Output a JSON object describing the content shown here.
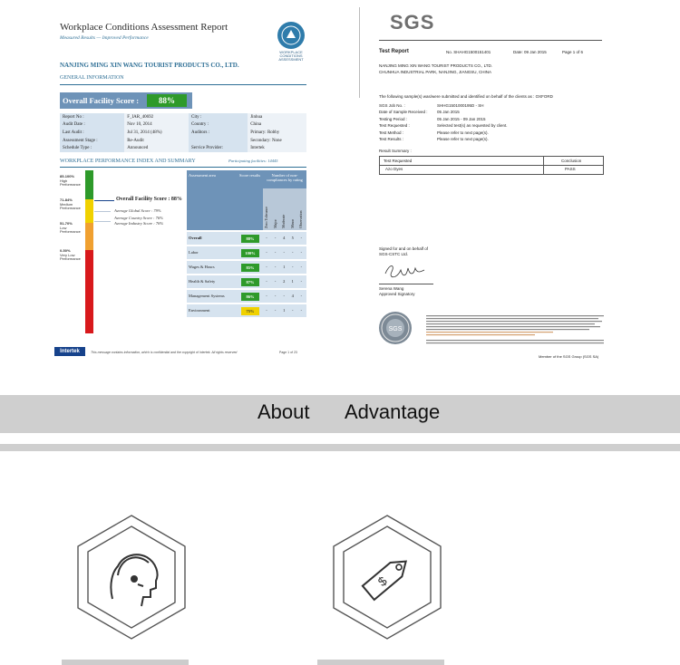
{
  "report": {
    "title": "Workplace Conditions Assessment Report",
    "subtitle": "Measured Results — Improved Performance",
    "logo_text": "WORKPLACE CONDITIONS ASSESSMENT",
    "company": "NANJING MING XIN WANG TOURIST PRODUCTS CO., LTD.",
    "general_info_header": "GENERAL INFORMATION",
    "overall_label": "Overall Facility Score :",
    "overall_value": "88%",
    "info_rows": [
      [
        "Report No :",
        "F_IAR_40692",
        "City :",
        "Jinhua"
      ],
      [
        "Audit Date :",
        "Nov 10, 2014",
        "Country :",
        "China"
      ],
      [
        "Last Audit :",
        "Jul 31, 2014 (48%)",
        "Auditors :",
        "Primary: Robby"
      ],
      [
        "Assessment Stage :",
        "Re-Audit",
        "",
        "Secondary: None"
      ],
      [
        "Schedule Type :",
        "Announced",
        "Service Provider:",
        "Intertek"
      ]
    ],
    "summary_header": "WORKPLACE PERFORMANCE INDEX AND SUMMARY",
    "participating": "Participating facilities: 14445",
    "bands": [
      {
        "range": "85-100%",
        "label": "High Performance"
      },
      {
        "range": "71-84%",
        "label": "Medium Performance"
      },
      {
        "range": "51-70%",
        "label": "Low Performance"
      },
      {
        "range": "0-50%",
        "label": "Very Low Performance"
      }
    ],
    "facility_score": "Overall Facility Score : 88%",
    "global_score": "Average Global Score : 79%",
    "country_score": "Average Country Score : 76%",
    "industry_score": "Average Industry Score : 76%",
    "table_headers": {
      "area": "Assessment area",
      "results": "Score results",
      "nc": "Number of non-compliances by rating",
      "sub": [
        "Zero Tolerance",
        "Major",
        "Moderate",
        "Minor",
        "Observation"
      ]
    },
    "table_rows": [
      {
        "area": "Overall",
        "score": "88%",
        "color": "#2e9a2a",
        "nc": [
          "-",
          "-",
          "4",
          "5",
          "-"
        ]
      },
      {
        "area": "Labor",
        "score": "100%",
        "color": "#2e9a2a",
        "nc": [
          "-",
          "-",
          "-",
          "-",
          "-"
        ]
      },
      {
        "area": "Wages & Hours",
        "score": "85%",
        "color": "#2e9a2a",
        "nc": [
          "-",
          "-",
          "1",
          "-",
          "-"
        ]
      },
      {
        "area": "Health & Safety",
        "score": "87%",
        "color": "#2e9a2a",
        "nc": [
          "-",
          "-",
          "2",
          "1",
          "-"
        ]
      },
      {
        "area": "Management Systems",
        "score": "86%",
        "color": "#2e9a2a",
        "nc": [
          "-",
          "-",
          "-",
          "4",
          "-"
        ]
      },
      {
        "area": "Environment",
        "score": "75%",
        "color": "#f0d100",
        "nc": [
          "-",
          "-",
          "1",
          "-",
          "-"
        ]
      }
    ],
    "brand": "Intertek",
    "footer": "This message contains information, which is confidential and the copyright of Intertek. All rights reserved",
    "page": "Page 1 of 23"
  },
  "sgs": {
    "logo": "SGS",
    "test_report": "Test Report",
    "report_no": "No. SHAHG1500151401",
    "date": "Date: 09 Jan 2015",
    "page": "Page 1 of 6",
    "company": "NANJING MING XIN WANG TOURIST PRODUCTS CO., LTD.",
    "address": "CHUNHUA INDUSTRIAL PARK, NANJING, JIANGSU, CHINA",
    "intro": "The following sample(s) was/were submitted and identified on behalf of the clients as : OXFORD",
    "fields": [
      [
        "SGS Job No. :",
        "SHHG1501000195D - SH"
      ],
      [
        "Date of Sample Received :",
        "05 Jan 2015"
      ],
      [
        "Testing Period :",
        "05 Jan 2015 - 09 Jan 2015"
      ],
      [
        "Test Requested :",
        "Selected test(s) as requested by client."
      ],
      [
        "Test Method :",
        "Please refer to next page(s)."
      ],
      [
        "Test Results :",
        "Please refer to next page(s)."
      ]
    ],
    "result_summary": "Result Summary :",
    "result_headers": [
      "Test Requested",
      "Conclusion"
    ],
    "result_row": [
      "Azo Dyes",
      "PASS"
    ],
    "signed_for": "Signed for and on behalf of",
    "signed_company": "SGS-CSTC Ltd.",
    "signature_name": "Serena Wang",
    "signature_role": "Approved Signatory",
    "member_text": "Member of the SGS Group (SGS SA)"
  },
  "tabs": {
    "about": "About",
    "advantage": "Advantage"
  },
  "features": [
    {
      "icon": "customer-service-icon"
    },
    {
      "icon": "price-tag-icon"
    }
  ]
}
